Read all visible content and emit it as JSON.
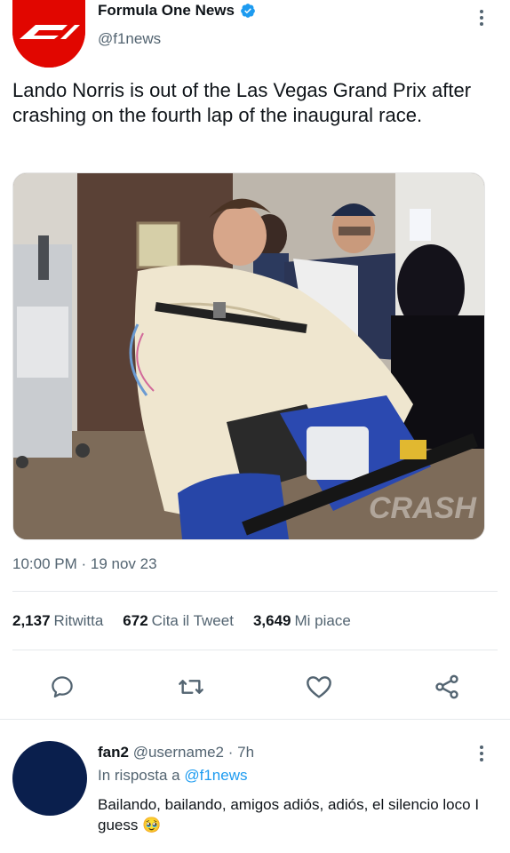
{
  "tweet": {
    "author": {
      "display_name": "Formula One News",
      "handle": "@f1news",
      "verified": true,
      "avatar_color": "#e10600"
    },
    "text": "Lando Norris is out of the Las Vegas Grand Prix after crashing on the fourth lap of the inaugural race.",
    "image_overlay_text": "CRASH",
    "timestamp": "10:00 PM · 19 nov 23",
    "stats": {
      "retweets_count": "2,137",
      "retweets_label": "Ritwitta",
      "quotes_count": "672",
      "quotes_label": "Cita il Tweet",
      "likes_count": "3,649",
      "likes_label": "Mi piace"
    },
    "actions": [
      "reply-icon",
      "retweet-icon",
      "like-icon",
      "share-icon"
    ]
  },
  "reply": {
    "display_name": "fan2",
    "handle_time": "@username2 · 7h",
    "in_reply_prefix": "In risposta a",
    "in_reply_handle": "@f1news",
    "text": "Bailando, bailando, amigos adiós, adiós, el silencio loco I guess 🥹",
    "avatar_color": "#0a1f4d"
  },
  "colors": {
    "text_primary": "#0f1419",
    "text_secondary": "#536471",
    "accent": "#1d9bf0",
    "divider": "#e6e9ec"
  }
}
